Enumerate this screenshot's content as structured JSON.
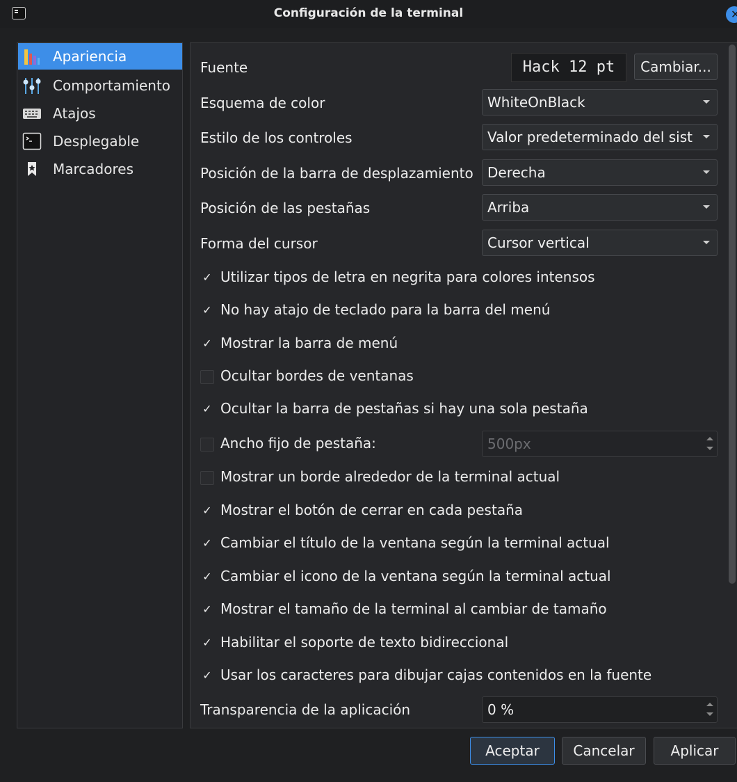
{
  "window": {
    "title": "Configuración de la terminal"
  },
  "sidebar": {
    "items": [
      {
        "label": "Apariencia",
        "icon": "palette-icon",
        "active": true
      },
      {
        "label": "Comportamiento",
        "icon": "sliders-icon"
      },
      {
        "label": "Atajos",
        "icon": "keyboard-icon"
      },
      {
        "label": "Desplegable",
        "icon": "terminal-icon"
      },
      {
        "label": "Marcadores",
        "icon": "bookmark-icon"
      }
    ]
  },
  "appearance": {
    "font": {
      "label": "Fuente",
      "value": "Hack 12 pt",
      "change_button": "Cambiar..."
    },
    "color_scheme": {
      "label": "Esquema de color",
      "value": "WhiteOnBlack"
    },
    "widget_style": {
      "label": "Estilo de los controles",
      "value": "Valor predeterminado del sist"
    },
    "scrollbar_position": {
      "label": "Posición de la barra de desplazamiento",
      "value": "Derecha"
    },
    "tab_position": {
      "label": "Posición de las pestañas",
      "value": "Arriba"
    },
    "cursor_shape": {
      "label": "Forma del cursor",
      "value": "Cursor vertical"
    },
    "checks": [
      {
        "label": "Utilizar tipos de letra en negrita para colores intensos",
        "checked": true
      },
      {
        "label": "No hay atajo de teclado para la barra del menú",
        "checked": true
      },
      {
        "label": "Mostrar la barra de menú",
        "checked": true
      },
      {
        "label": "Ocultar bordes de ventanas",
        "checked": false
      },
      {
        "label": "Ocultar la barra de pestañas si hay una sola pestaña",
        "checked": true
      },
      {
        "label": "Ancho fijo de pestaña:",
        "checked": false
      },
      {
        "label": "Mostrar un borde alrededor de la terminal actual",
        "checked": false
      },
      {
        "label": "Mostrar el botón de cerrar en cada pestaña",
        "checked": true
      },
      {
        "label": "Cambiar el título de la ventana según la terminal actual",
        "checked": true
      },
      {
        "label": "Cambiar el icono de la ventana según la terminal actual",
        "checked": true
      },
      {
        "label": "Mostrar el tamaño de la terminal al cambiar de tamaño",
        "checked": true
      },
      {
        "label": "Habilitar el soporte de texto bidireccional",
        "checked": true
      },
      {
        "label": "Usar los caracteres para dibujar cajas contenidos en la fuente",
        "checked": true
      }
    ],
    "fixed_tab_width_value": "500px",
    "transparency": {
      "label": "Transparencia de la aplicación",
      "value": "0 %"
    }
  },
  "buttons": {
    "ok": "Aceptar",
    "cancel": "Cancelar",
    "apply": "Aplicar"
  },
  "check_mark": "✓",
  "colors": {
    "accent": "#3d8ee8",
    "background": "#1f2022",
    "panel": "#26272a"
  }
}
